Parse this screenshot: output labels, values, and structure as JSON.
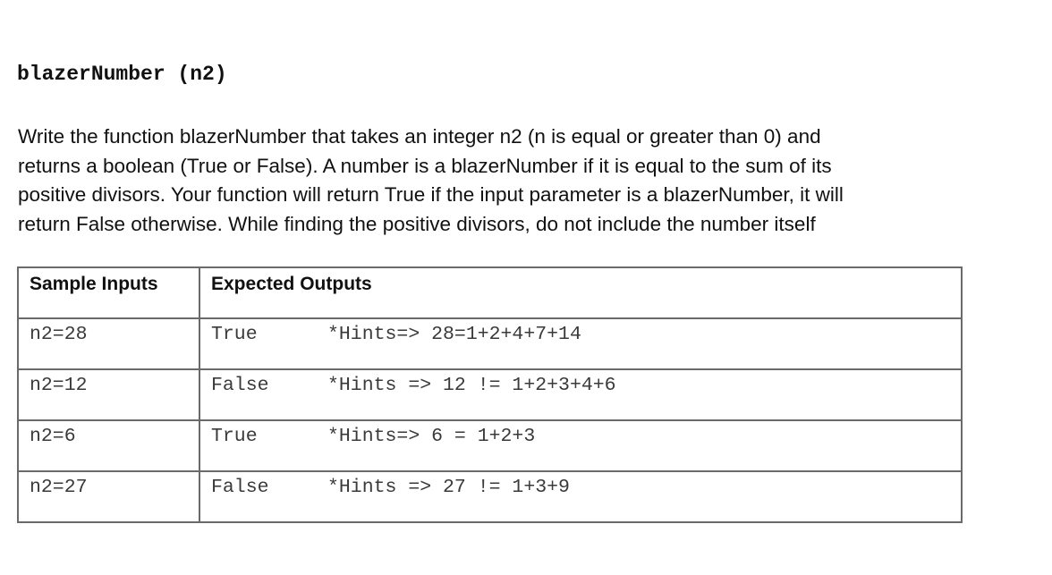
{
  "function_signature": "blazerNumber (n2)",
  "description_lines": [
    "Write the function blazerNumber that takes an integer n2 (n is equal or greater than 0) and",
    "returns a boolean (True or False). A number is a blazerNumber if it is equal to the sum of its",
    "positive divisors. Your function will return True if the input parameter is a blazerNumber, it will",
    "return False otherwise. While finding the positive divisors, do not include the number itself"
  ],
  "table": {
    "headers": [
      "Sample Inputs",
      "Expected Outputs"
    ],
    "rows": [
      {
        "input": "n2=28",
        "output": "True",
        "hint": "*Hints=> 28=1+2+4+7+14"
      },
      {
        "input": "n2=12",
        "output": "False",
        "hint": "*Hints => 12 != 1+2+3+4+6"
      },
      {
        "input": "n2=6",
        "output": "True",
        "hint": "*Hints=> 6 = 1+2+3"
      },
      {
        "input": "n2=27",
        "output": "False",
        "hint": "*Hints => 27 != 1+3+9"
      }
    ]
  }
}
